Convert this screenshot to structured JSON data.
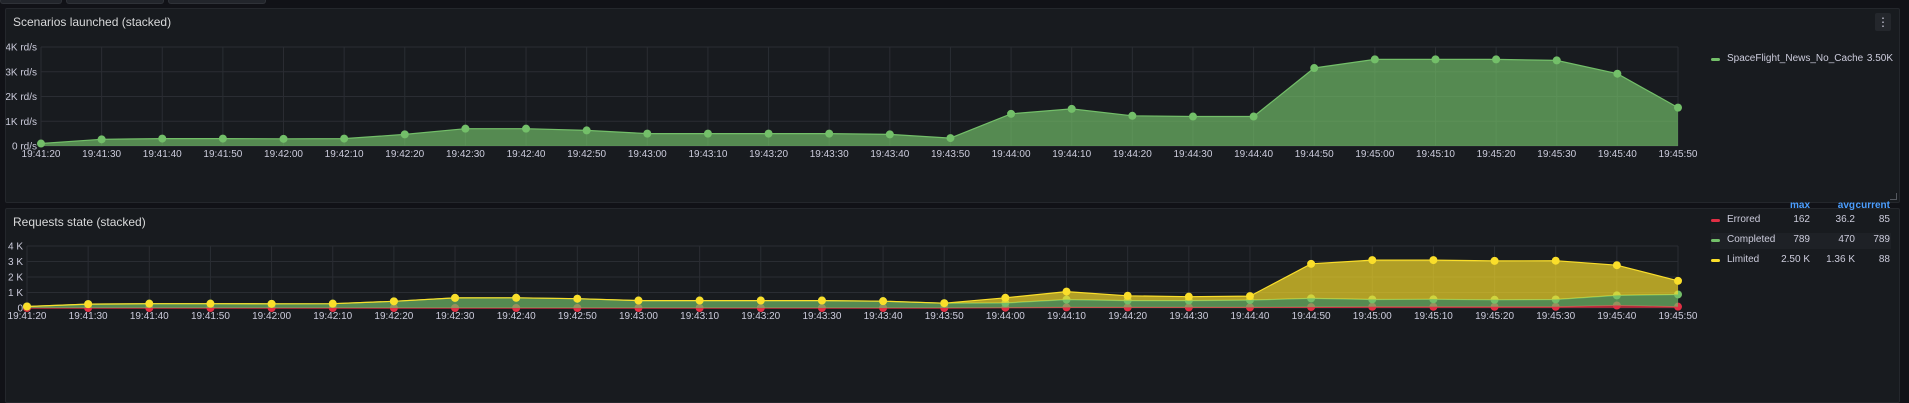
{
  "panels": [
    {
      "title": "Scenarios launched (stacked)",
      "menu_icon": "more-vertical-icon",
      "legend": [
        {
          "color": "#73bf69",
          "label": "SpaceFlight_News_No_Cache",
          "values": [
            "3.50K"
          ]
        }
      ]
    },
    {
      "title": "Requests state (stacked)",
      "menu_icon": "more-vertical-icon",
      "legend_headers": [
        "max",
        "avg",
        "current"
      ],
      "legend": [
        {
          "color": "#e02f44",
          "label": "Errored",
          "values": [
            "162",
            "36.2",
            "85"
          ]
        },
        {
          "color": "#73bf69",
          "label": "Completed",
          "values": [
            "789",
            "470",
            "789"
          ]
        },
        {
          "color": "#fade2a",
          "label": "Limited",
          "values": [
            "2.50 K",
            "1.36 K",
            "88"
          ]
        }
      ]
    }
  ],
  "chart_data": [
    {
      "type": "area",
      "title": "Scenarios launched (stacked)",
      "stacked": true,
      "x": [
        "19:41:20",
        "19:41:30",
        "19:41:40",
        "19:41:50",
        "19:42:00",
        "19:42:10",
        "19:42:20",
        "19:42:30",
        "19:42:40",
        "19:42:50",
        "19:43:00",
        "19:43:10",
        "19:43:20",
        "19:43:30",
        "19:43:40",
        "19:43:50",
        "19:44:00",
        "19:44:10",
        "19:44:20",
        "19:44:30",
        "19:44:40",
        "19:44:50",
        "19:45:00",
        "19:45:10",
        "19:45:20",
        "19:45:30",
        "19:45:40",
        "19:45:50"
      ],
      "yticks": [
        "0 rd/s",
        "1K rd/s",
        "2K rd/s",
        "3K rd/s",
        "4K rd/s"
      ],
      "ylim": [
        0,
        4000
      ],
      "grid": true,
      "legend_position": "right",
      "series": [
        {
          "name": "SpaceFlight_News_No_Cache",
          "color": "#73bf69",
          "values": [
            100,
            270,
            300,
            300,
            290,
            300,
            470,
            700,
            700,
            630,
            500,
            500,
            500,
            500,
            470,
            320,
            1300,
            1500,
            1220,
            1190,
            1190,
            3150,
            3500,
            3500,
            3500,
            3460,
            2920,
            1550
          ]
        }
      ]
    },
    {
      "type": "area",
      "title": "Requests state (stacked)",
      "stacked": true,
      "x": [
        "19:41:20",
        "19:41:30",
        "19:41:40",
        "19:41:50",
        "19:42:00",
        "19:42:10",
        "19:42:20",
        "19:42:30",
        "19:42:40",
        "19:42:50",
        "19:43:00",
        "19:43:10",
        "19:43:20",
        "19:43:30",
        "19:43:40",
        "19:43:50",
        "19:44:00",
        "19:44:10",
        "19:44:20",
        "19:44:30",
        "19:44:40",
        "19:44:50",
        "19:45:00",
        "19:45:10",
        "19:45:20",
        "19:45:30",
        "19:45:40",
        "19:45:50"
      ],
      "yticks": [
        "0",
        "1 K",
        "2 K",
        "3 K",
        "4 K"
      ],
      "ylim": [
        0,
        4000
      ],
      "grid": true,
      "legend_position": "right",
      "series": [
        {
          "name": "Errored",
          "color": "#e02f44",
          "values": [
            0,
            0,
            0,
            0,
            0,
            0,
            0,
            0,
            0,
            0,
            0,
            0,
            0,
            0,
            0,
            0,
            20,
            40,
            40,
            40,
            40,
            60,
            80,
            80,
            80,
            80,
            162,
            85
          ]
        },
        {
          "name": "Completed",
          "color": "#73bf69",
          "values": [
            100,
            250,
            280,
            280,
            270,
            280,
            430,
            650,
            660,
            600,
            480,
            480,
            480,
            480,
            440,
            310,
            300,
            500,
            440,
            440,
            470,
            560,
            470,
            480,
            450,
            470,
            650,
            789
          ]
        },
        {
          "name": "Limited",
          "color": "#fade2a",
          "values": [
            0,
            0,
            0,
            0,
            0,
            0,
            0,
            0,
            0,
            0,
            0,
            0,
            0,
            0,
            0,
            0,
            340,
            520,
            310,
            250,
            260,
            2230,
            2540,
            2530,
            2510,
            2500,
            1950,
            880
          ]
        }
      ]
    }
  ]
}
